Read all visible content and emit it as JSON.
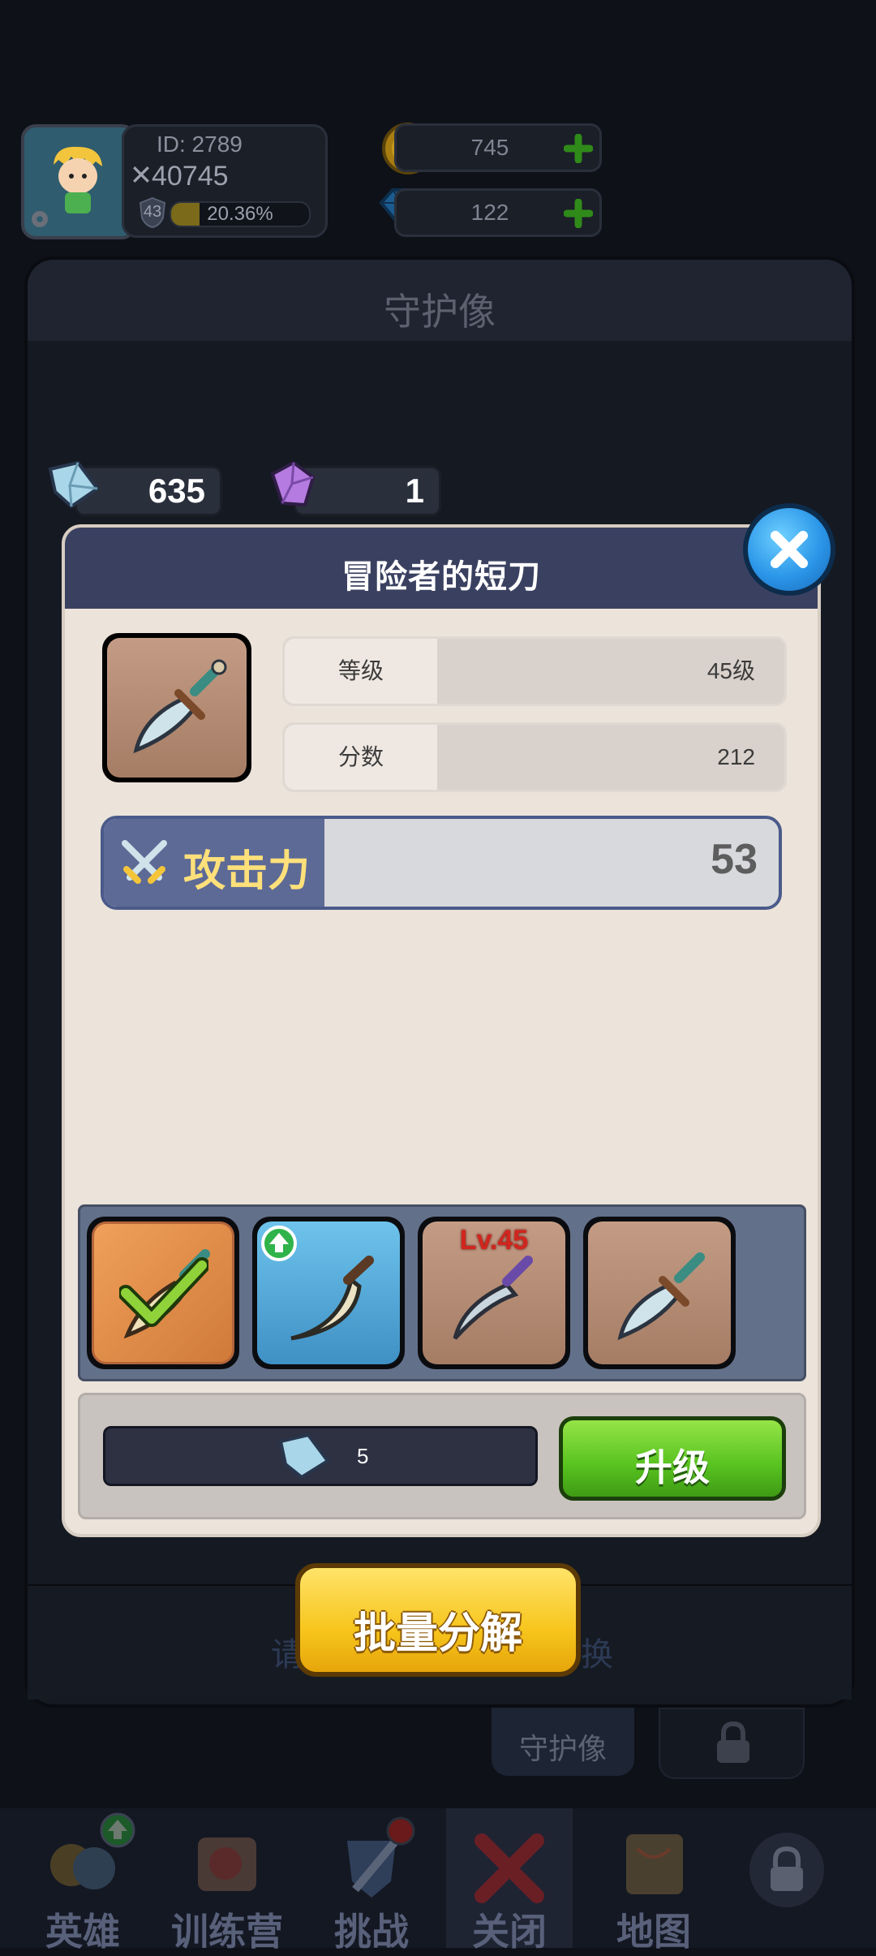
{
  "player": {
    "id_text": "ID:  2789",
    "power": "40745",
    "level": "43",
    "exp_percent_text": "20.36%",
    "exp_fraction": 0.2036
  },
  "resources": {
    "gold": "745",
    "diamond": "122"
  },
  "background_window": {
    "title": "守护像",
    "footer_text": "请",
    "footer_text_right": "换",
    "tab_label": "守护像"
  },
  "currency": {
    "blue_crystal": "635",
    "purple_crystal": "1"
  },
  "dialog": {
    "title": "冒险者的短刀",
    "stats": [
      {
        "label": "等级",
        "value": "45级"
      },
      {
        "label": "分数",
        "value": "212"
      }
    ],
    "attack_label": "攻击力",
    "attack_value": "53",
    "materials": [
      {
        "name": "slot-selected",
        "badge": ""
      },
      {
        "name": "slot-upgrade-available",
        "badge": ""
      },
      {
        "name": "slot-level",
        "badge": "Lv.45"
      },
      {
        "name": "slot-plain",
        "badge": ""
      }
    ],
    "cost_value": "5",
    "upgrade_label": "升级"
  },
  "batch_button_label": "批量分解",
  "nav": [
    {
      "label": "英雄"
    },
    {
      "label": "训练营"
    },
    {
      "label": "挑战"
    },
    {
      "label": "关闭"
    },
    {
      "label": "地图"
    },
    {
      "label": ""
    }
  ],
  "colors": {
    "dialog_header": "#3a4160",
    "upgrade_green": "#57c21f",
    "batch_yellow": "#f7c51c",
    "close_blue": "#2b96e8"
  }
}
